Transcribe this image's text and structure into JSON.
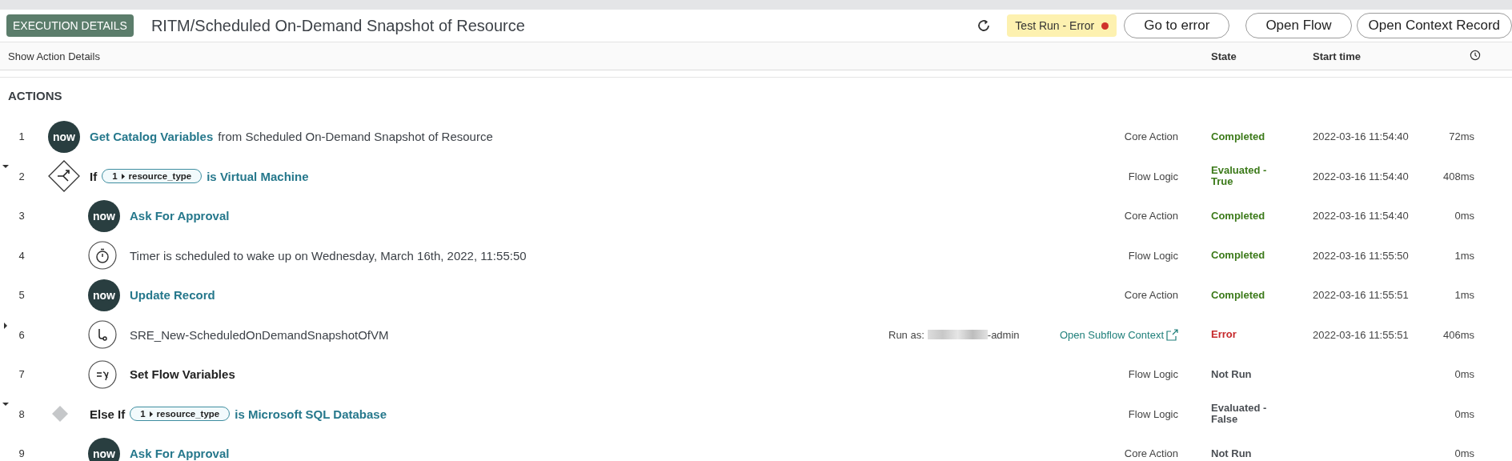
{
  "header": {
    "badge": "EXECUTION DETAILS",
    "title": "RITM/Scheduled On-Demand Snapshot of Resource",
    "status": {
      "label": "Test Run - Error",
      "color": "#d0322b"
    },
    "buttons": [
      "Go to error",
      "Open Flow",
      "Open Context Record"
    ]
  },
  "columns": {
    "toggle_label": "Show Action Details",
    "state": "State",
    "start_time": "Start time"
  },
  "section_title": "ACTIONS",
  "rows": [
    {
      "number": "1",
      "kind": "now",
      "logo": "now",
      "title": [
        {
          "kind": "link",
          "text": "Get Catalog Variables"
        },
        {
          "kind": "plain",
          "text": "from Scheduled On-Demand Snapshot of Resource"
        }
      ],
      "type": "Core Action",
      "state": {
        "text": "Completed",
        "kind": "success"
      },
      "start": "2022-03-16 11:54:40",
      "duration": "72ms"
    },
    {
      "number": "2",
      "kind": "branch",
      "expanded": true,
      "title": [
        {
          "kind": "keyword",
          "text": "If"
        },
        {
          "kind": "pill",
          "step": "1",
          "field": "resource_type"
        },
        {
          "kind": "link",
          "text": "is Virtual Machine"
        }
      ],
      "type": "Flow Logic",
      "state": {
        "text": "Evaluated - True",
        "kind": "success"
      },
      "start": "2022-03-16 11:54:40",
      "duration": "408ms",
      "children": [
        {
          "number": "3",
          "kind": "now",
          "logo": "now",
          "title": [
            {
              "kind": "link",
              "text": "Ask For Approval"
            }
          ],
          "type": "Core Action",
          "state": {
            "text": "Completed",
            "kind": "success"
          },
          "start": "2022-03-16 11:54:40",
          "duration": "0ms"
        },
        {
          "number": "4",
          "kind": "timer",
          "title": [
            {
              "kind": "plain",
              "text": "Timer is scheduled to wake up on Wednesday, March 16th, 2022, 11:55:50"
            }
          ],
          "type": "Flow Logic",
          "state": {
            "text": "Completed",
            "kind": "success"
          },
          "start": "2022-03-16 11:55:50",
          "duration": "1ms"
        },
        {
          "number": "5",
          "kind": "now",
          "logo": "now",
          "title": [
            {
              "kind": "link",
              "text": "Update Record"
            }
          ],
          "type": "Core Action",
          "state": {
            "text": "Completed",
            "kind": "success"
          },
          "start": "2022-03-16 11:55:51",
          "duration": "1ms"
        },
        {
          "number": "6",
          "kind": "subflow",
          "expanded": false,
          "title": [
            {
              "kind": "plain",
              "text": "SRE_New-ScheduledOnDemandSnapshotOfVM"
            }
          ],
          "run_as": {
            "label": "Run as:",
            "suffix": "-admin"
          },
          "link": "Open Subflow Context",
          "state": {
            "text": "Error",
            "kind": "error"
          },
          "start": "2022-03-16 11:55:51",
          "duration": "406ms"
        },
        {
          "number": "7",
          "kind": "variables",
          "title": [
            {
              "kind": "strong",
              "text": "Set Flow Variables"
            }
          ],
          "type": "Flow Logic",
          "state": {
            "text": "Not Run",
            "kind": "neutral"
          },
          "duration": "0ms"
        }
      ]
    },
    {
      "number": "8",
      "kind": "else",
      "expanded": true,
      "title": [
        {
          "kind": "keyword",
          "text": "Else If"
        },
        {
          "kind": "pill",
          "step": "1",
          "field": "resource_type"
        },
        {
          "kind": "link",
          "text": "is Microsoft SQL Database"
        }
      ],
      "type": "Flow Logic",
      "state": {
        "text": "Evaluated - False",
        "kind": "neutral"
      },
      "duration": "0ms",
      "children": [
        {
          "number": "9",
          "kind": "now",
          "logo": "now",
          "title": [
            {
              "kind": "link",
              "text": "Ask For Approval"
            }
          ],
          "type": "Core Action",
          "state": {
            "text": "Not Run",
            "kind": "neutral"
          },
          "duration": "0ms"
        }
      ]
    }
  ]
}
